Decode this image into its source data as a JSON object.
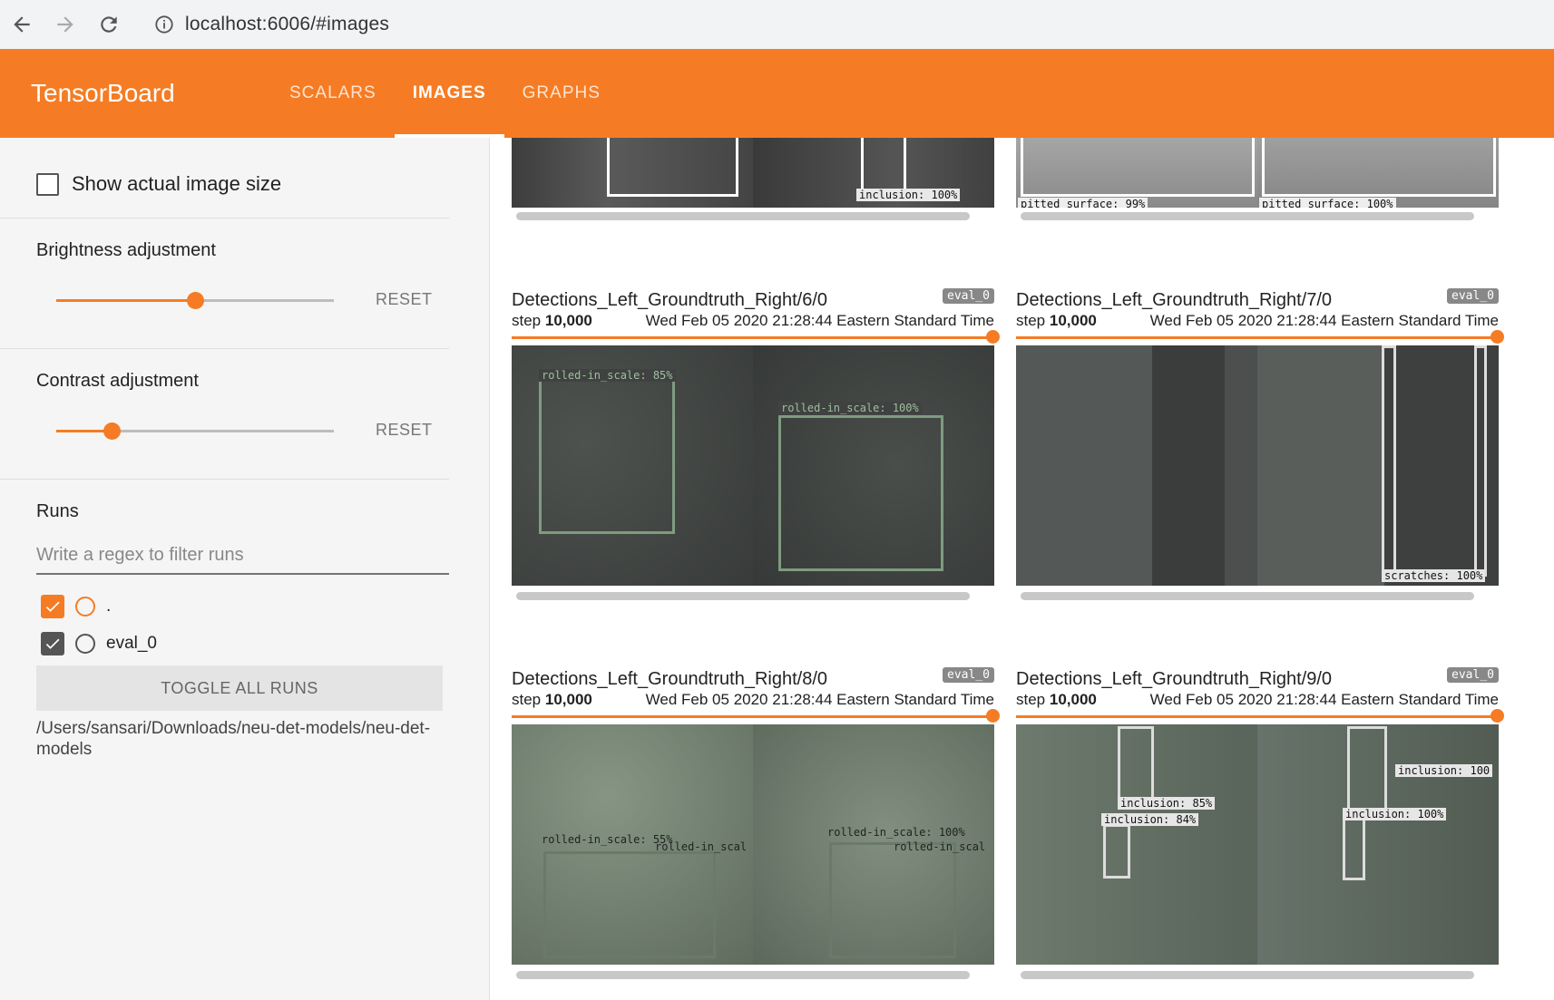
{
  "browser": {
    "url": "localhost:6006/#images"
  },
  "header": {
    "brand": "TensorBoard",
    "tabs": [
      {
        "label": "SCALARS",
        "active": false
      },
      {
        "label": "IMAGES",
        "active": true
      },
      {
        "label": "GRAPHS",
        "active": false
      }
    ]
  },
  "sidebar": {
    "show_actual_size": {
      "label": "Show actual image size",
      "checked": false
    },
    "brightness": {
      "title": "Brightness adjustment",
      "value": 0.5,
      "reset": "RESET"
    },
    "contrast": {
      "title": "Contrast adjustment",
      "value": 0.2,
      "reset": "RESET"
    },
    "runs": {
      "title": "Runs",
      "filter_placeholder": "Write a regex to filter runs",
      "items": [
        {
          "name": ".",
          "checked": true,
          "color": "#f57c24"
        },
        {
          "name": "eval_0",
          "checked": true,
          "color": "#555555"
        }
      ],
      "toggle_label": "TOGGLE ALL RUNS",
      "logdir": "/Users/sansari/Downloads/neu-det-models/neu-det-models"
    }
  },
  "cards": [
    {
      "title": "",
      "run": "",
      "step_label": "",
      "step": "",
      "time": "",
      "labels": [
        "inclusion: 100%",
        "pitted_surface: 99%",
        "pitted_surface: 100%"
      ]
    },
    {
      "title": "Detections_Left_Groundtruth_Right/6/0",
      "run": "eval_0",
      "step_label": "step",
      "step": "10,000",
      "time": "Wed Feb 05 2020 21:28:44 Eastern Standard Time",
      "labels": [
        "rolled-in_scale: 85%",
        "rolled-in_scale: 100%"
      ]
    },
    {
      "title": "Detections_Left_Groundtruth_Right/7/0",
      "run": "eval_0",
      "step_label": "step",
      "step": "10,000",
      "time": "Wed Feb 05 2020 21:28:44 Eastern Standard Time",
      "labels": [
        "scratches: 100%"
      ]
    },
    {
      "title": "Detections_Left_Groundtruth_Right/8/0",
      "run": "eval_0",
      "step_label": "step",
      "step": "10,000",
      "time": "Wed Feb 05 2020 21:28:44 Eastern Standard Time",
      "labels": [
        "rolled-in_scale: 55%",
        "rolled-in_scal",
        "rolled-in_scale: 100%",
        "rolled-in_scal"
      ]
    },
    {
      "title": "Detections_Left_Groundtruth_Right/9/0",
      "run": "eval_0",
      "step_label": "step",
      "step": "10,000",
      "time": "Wed Feb 05 2020 21:28:44 Eastern Standard Time",
      "labels": [
        "inclusion: 85%",
        "inclusion: 84%",
        "inclusion: 100",
        "inclusion: 100%"
      ]
    }
  ],
  "colors": {
    "accent": "#f57c24"
  }
}
